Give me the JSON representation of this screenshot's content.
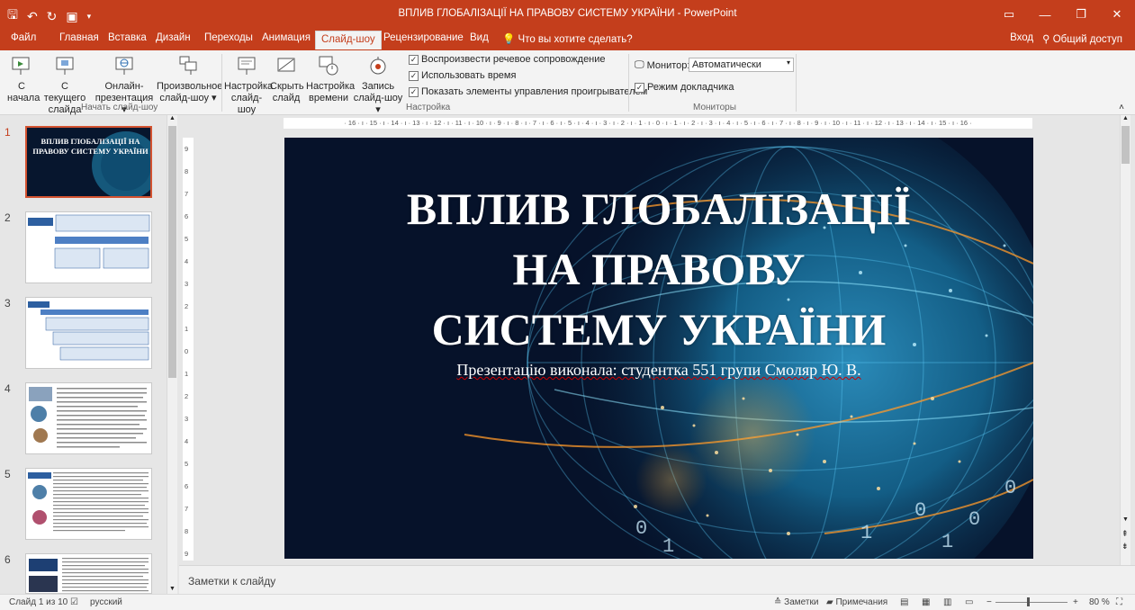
{
  "window": {
    "title": "ВПЛИВ ГЛОБАЛІЗАЦІЇ НА ПРАВОВУ СИСТЕМУ УКРАЇНИ - PowerPoint"
  },
  "tabs": [
    "Файл",
    "Главная",
    "Вставка",
    "Дизайн",
    "Переходы",
    "Анимация",
    "Слайд-шоу",
    "Рецензирование",
    "Вид"
  ],
  "tell_me": "Что вы хотите сделать?",
  "account": {
    "signin": "Вход",
    "share": "Общий доступ"
  },
  "ribbon": {
    "start": {
      "from_start_1": "С",
      "from_start_2": "начала",
      "from_current_1": "С текущего",
      "from_current_2": "слайда",
      "online_1": "Онлайн-",
      "online_2": "презентация",
      "custom_1": "Произвольное",
      "custom_2": "слайд-шоу",
      "group_label": "Начать слайд-шоу"
    },
    "setup": {
      "setup_1": "Настройка",
      "setup_2": "слайд-шоу",
      "hide_1": "Скрыть",
      "hide_2": "слайд",
      "rehearse_1": "Настройка",
      "rehearse_2": "времени",
      "record_1": "Запись",
      "record_2": "слайд-шоу",
      "chk_narration": "Воспроизвести речевое сопровождение",
      "chk_timings": "Использовать время",
      "chk_controls": "Показать элементы управления проигрывателем",
      "group_label": "Настройка"
    },
    "monitors": {
      "monitor_label": "Монитор:",
      "monitor_value": "Автоматически",
      "presenter_view": "Режим докладчика",
      "group_label": "Мониторы"
    }
  },
  "thumbnails": [
    {
      "num": "1",
      "title": "ВПЛИВ ГЛОБАЛІЗАЦІЇ НА ПРАВОВУ СИСТЕМУ УКРАЇНИ"
    },
    {
      "num": "2"
    },
    {
      "num": "3"
    },
    {
      "num": "4"
    },
    {
      "num": "5"
    },
    {
      "num": "6"
    }
  ],
  "ruler": {
    "horizontal": "· 16 · ı · 15 · ı · 14 · ı · 13 · ı · 12 · ı · 11 · ı · 10 · ı · 9 · ı · 8 · ı · 7 · ı · 6 · ı · 5 · ı · 4 · ı · 3 · ı · 2 · ı · 1 · ı · 0 · ı · 1 · ı · 2 · ı · 3 · ı · 4 · ı · 5 · ı · 6 · ı · 7 · ı · 8 · ı · 9 · ı · 10 · ı · 11 · ı · 12 · ı · 13 · ı · 14 · ı · 15 · ı · 16 ·",
    "vertical": [
      "9",
      "8",
      "7",
      "6",
      "5",
      "4",
      "3",
      "2",
      "1",
      "0",
      "1",
      "2",
      "3",
      "4",
      "5",
      "6",
      "7",
      "8",
      "9"
    ]
  },
  "slide": {
    "title_lines": [
      "ВПЛИВ ГЛОБАЛІЗАЦІЇ",
      "НА ПРАВОВУ",
      "СИСТЕМУ УКРАЇНИ"
    ],
    "subtitle": "Презентацію виконала: студентка 551 групи Смоляр Ю. В."
  },
  "notes_placeholder": "Заметки к слайду",
  "status": {
    "slide_count": "Слайд 1 из 10",
    "language": "русский",
    "notes": "Заметки",
    "comments": "Примечания",
    "zoom": "80 %"
  },
  "colors": {
    "accent": "#c43e1c",
    "slide_bg": "#06122a"
  }
}
